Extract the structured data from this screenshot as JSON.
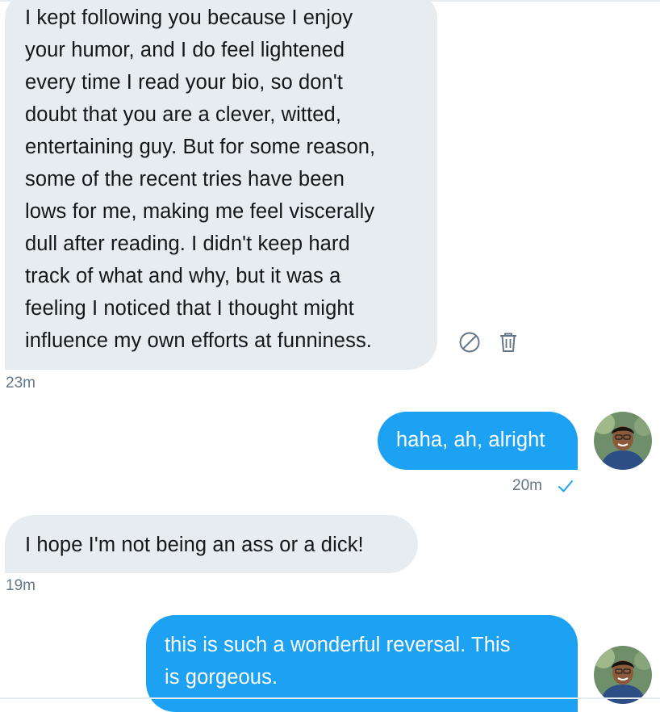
{
  "messages": [
    {
      "direction": "received",
      "text": "I kept following you because I enjoy\nyour humor, and I do feel lightened\nevery time I read your bio, so don't\ndoubt that you are a clever, witted,\nentertaining guy. But for some reason,\nsome of the recent tries have been\nlows for me, making me feel viscerally\ndull after reading. I didn't keep hard\ntrack of what and why, but it was a\nfeeling I noticed that I thought might\ninfluence my own efforts at funniness.",
      "time": "23m"
    },
    {
      "direction": "sent",
      "text": "haha, ah, alright",
      "time": "20m",
      "status_icon": "checkmark-icon"
    },
    {
      "direction": "received",
      "text": "I hope I'm not being an ass or a dick!",
      "time": "19m"
    },
    {
      "direction": "sent",
      "text": "this is such a wonderful reversal. This\nis gorgeous.",
      "time": ""
    }
  ],
  "hover_actions": {
    "icons": [
      "block-icon",
      "trash-icon"
    ]
  },
  "colors": {
    "sent_bubble": "#1da1f2",
    "received_bubble": "#e6ecf0",
    "timestamp": "#657786",
    "text_dark": "#14171a"
  }
}
